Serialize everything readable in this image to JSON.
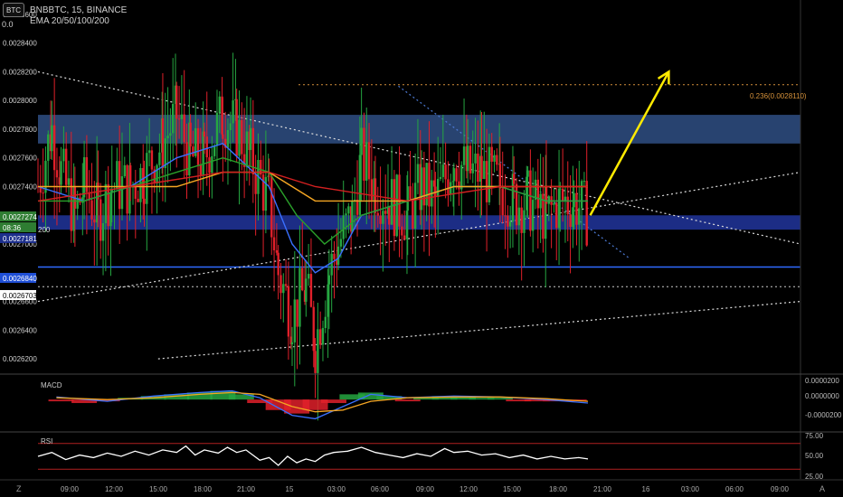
{
  "header": {
    "badge": "BTC",
    "symbol_line": "BNBBTC, 15, BINANCE",
    "indicator_line": "EMA 20/50/100/200",
    "partial_top_label": "0.0"
  },
  "price_labels": {
    "current_price": "0.0027274",
    "countdown": "08:36",
    "partial_label": "200",
    "level_price": "0.0027181",
    "support_price": "0.0026840",
    "dotted_price": "0.0026703"
  },
  "fib_label": "0.236(0.0028110)",
  "macd": {
    "label": "MACD",
    "ticks": [
      "0.0000200",
      "0.0000000",
      "-0.0000200"
    ]
  },
  "rsi": {
    "label": "RSI",
    "ticks": [
      "75.00",
      "50.00",
      "25.00"
    ]
  },
  "corner_icons": {
    "left": "Z",
    "right": "A"
  },
  "colors": {
    "background": "#000000",
    "up_candle": "#26a641",
    "down_candle": "#e0202a",
    "supply_zone": "#2c4a7c",
    "demand_zone": "#1d2f8c",
    "arrow": "#ffea00",
    "fib": "#d4903a",
    "rsi_line": "#ffffff",
    "rsi_bands": "#b02020"
  },
  "chart_data": {
    "type": "candlestick",
    "y_axis_ticks": [
      "0.0028600",
      "0.0028400",
      "0.0028200",
      "0.0028000",
      "0.0027800",
      "0.0027600",
      "0.0027400",
      "0.0027000",
      "0.0026600",
      "0.0026400",
      "0.0026200"
    ],
    "ylim": [
      0.00261,
      0.00287
    ],
    "x_ticks": [
      "09:00",
      "12:00",
      "15:00",
      "18:00",
      "21:00",
      "15",
      "03:00",
      "06:00",
      "09:00",
      "12:00",
      "15:00",
      "18:00",
      "21:00",
      "16",
      "03:00",
      "06:00",
      "09:00"
    ],
    "xlim": [
      0,
      16.5
    ],
    "price_path": [
      [
        0.0,
        0.00274
      ],
      [
        0.3,
        0.00278
      ],
      [
        0.5,
        0.00275
      ],
      [
        0.8,
        0.00272
      ],
      [
        1.0,
        0.00274
      ],
      [
        1.3,
        0.00272
      ],
      [
        1.6,
        0.00274
      ],
      [
        2.0,
        0.00274
      ],
      [
        2.3,
        0.00275
      ],
      [
        2.7,
        0.00277
      ],
      [
        3.0,
        0.00279
      ],
      [
        3.3,
        0.00276
      ],
      [
        3.6,
        0.00276
      ],
      [
        4.0,
        0.00279
      ],
      [
        4.3,
        0.00278
      ],
      [
        4.6,
        0.00276
      ],
      [
        5.0,
        0.00273
      ],
      [
        5.2,
        0.00268
      ],
      [
        5.5,
        0.00265
      ],
      [
        5.8,
        0.00267
      ],
      [
        6.0,
        0.00263
      ],
      [
        6.3,
        0.00268
      ],
      [
        6.5,
        0.0027
      ],
      [
        6.8,
        0.00272
      ],
      [
        7.0,
        0.00276
      ],
      [
        7.3,
        0.00274
      ],
      [
        7.6,
        0.00273
      ],
      [
        8.0,
        0.00272
      ],
      [
        8.3,
        0.00274
      ],
      [
        8.6,
        0.00273
      ],
      [
        9.0,
        0.00276
      ],
      [
        9.3,
        0.00275
      ],
      [
        9.6,
        0.00275
      ],
      [
        10.0,
        0.00274
      ],
      [
        10.3,
        0.00273
      ],
      [
        10.6,
        0.00273
      ],
      [
        11.0,
        0.00272
      ],
      [
        11.3,
        0.00273
      ],
      [
        11.6,
        0.00273
      ],
      [
        11.9,
        0.00272
      ]
    ],
    "ema_lines": [
      {
        "name": "EMA 20",
        "color": "#3a70ff",
        "points": [
          [
            0,
            0.00274
          ],
          [
            1,
            0.00273
          ],
          [
            2,
            0.00274
          ],
          [
            3,
            0.00276
          ],
          [
            4,
            0.00277
          ],
          [
            5,
            0.00274
          ],
          [
            5.5,
            0.0027
          ],
          [
            6,
            0.00268
          ],
          [
            6.5,
            0.00269
          ],
          [
            7,
            0.00272
          ],
          [
            8,
            0.00273
          ],
          [
            9,
            0.00274
          ],
          [
            10,
            0.00274
          ],
          [
            11,
            0.00273
          ],
          [
            11.9,
            0.00273
          ]
        ]
      },
      {
        "name": "EMA 50",
        "color": "#2aa02a",
        "points": [
          [
            0,
            0.00273
          ],
          [
            1,
            0.00273
          ],
          [
            2,
            0.00274
          ],
          [
            3,
            0.00275
          ],
          [
            4,
            0.00276
          ],
          [
            5,
            0.00275
          ],
          [
            5.6,
            0.00272
          ],
          [
            6.2,
            0.0027
          ],
          [
            7,
            0.00272
          ],
          [
            8,
            0.00273
          ],
          [
            9,
            0.00274
          ],
          [
            10,
            0.00274
          ],
          [
            11,
            0.00273
          ],
          [
            11.9,
            0.00273
          ]
        ]
      },
      {
        "name": "EMA 100",
        "color": "#f5a623",
        "points": [
          [
            0,
            0.00274
          ],
          [
            1,
            0.00274
          ],
          [
            2,
            0.00274
          ],
          [
            3,
            0.00274
          ],
          [
            4,
            0.00275
          ],
          [
            5,
            0.00275
          ],
          [
            6,
            0.00273
          ],
          [
            7,
            0.00273
          ],
          [
            8,
            0.00273
          ],
          [
            9,
            0.00274
          ],
          [
            10,
            0.00274
          ],
          [
            11,
            0.00274
          ],
          [
            11.9,
            0.00274
          ]
        ]
      },
      {
        "name": "EMA 200",
        "color": "#d42020",
        "points": [
          [
            0,
            0.00273
          ],
          [
            2,
            0.00274
          ],
          [
            4,
            0.00275
          ],
          [
            5,
            0.00275
          ],
          [
            6,
            0.00274
          ],
          [
            8,
            0.00273
          ],
          [
            10,
            0.00274
          ],
          [
            11.9,
            0.00274
          ]
        ]
      }
    ],
    "zones": [
      {
        "name": "supply",
        "from": 0.00277,
        "to": 0.00279
      },
      {
        "name": "demand",
        "from": 0.00271,
        "to": 0.00272
      }
    ],
    "horizontal_lines": [
      {
        "name": "support",
        "value": 0.002684,
        "style": "solid"
      },
      {
        "name": "dotted",
        "value": 0.0026703,
        "style": "dotted"
      },
      {
        "name": "fib-0.236",
        "value": 0.002811,
        "style": "dotted"
      }
    ],
    "trendlines": [
      {
        "name": "descending-resistance",
        "from": [
          0,
          0.00282
        ],
        "to": [
          16.5,
          0.0027
        ]
      },
      {
        "name": "ascending-support",
        "from": [
          0,
          0.00266
        ],
        "to": [
          16.5,
          0.00275
        ]
      },
      {
        "name": "lower-ascending",
        "from": [
          2.6,
          0.00262
        ],
        "to": [
          16.5,
          0.00266
        ]
      },
      {
        "name": "steep-descending",
        "from": [
          7.8,
          0.00281
        ],
        "to": [
          12.8,
          0.00269
        ]
      }
    ],
    "arrow": {
      "from": [
        11.95,
        0.00272
      ],
      "to": [
        13.65,
        0.00282
      ]
    },
    "macd": {
      "ylim": [
        -3.5e-05,
        2.5e-05
      ],
      "histogram": [
        [
          0.5,
          -2e-06
        ],
        [
          1,
          -4e-06
        ],
        [
          1.5,
          -2e-06
        ],
        [
          2,
          2e-06
        ],
        [
          2.5,
          4e-06
        ],
        [
          3,
          6e-06
        ],
        [
          3.5,
          8e-06
        ],
        [
          4,
          1e-05
        ],
        [
          4.4,
          6e-06
        ],
        [
          4.8,
          -4e-06
        ],
        [
          5.2,
          -1.2e-05
        ],
        [
          5.6,
          -1.6e-05
        ],
        [
          6,
          -1.2e-05
        ],
        [
          6.4,
          -4e-06
        ],
        [
          6.8,
          6e-06
        ],
        [
          7.2,
          8e-06
        ],
        [
          7.6,
          4e-06
        ],
        [
          8,
          -2e-06
        ],
        [
          8.4,
          2e-06
        ],
        [
          8.8,
          4e-06
        ],
        [
          9.2,
          4e-06
        ],
        [
          9.6,
          2e-06
        ],
        [
          10,
          2e-06
        ],
        [
          10.4,
          -2e-06
        ],
        [
          10.8,
          -2e-06
        ],
        [
          11.2,
          -2e-06
        ],
        [
          11.6,
          -2e-06
        ]
      ],
      "macd_line": [
        [
          0.4,
          3e-06
        ],
        [
          1.5,
          -2e-06
        ],
        [
          2.5,
          4e-06
        ],
        [
          3.5,
          8e-06
        ],
        [
          4.2,
          1e-05
        ],
        [
          4.8,
          2e-06
        ],
        [
          5.5,
          -1.8e-05
        ],
        [
          6,
          -2.2e-05
        ],
        [
          6.6,
          -8e-06
        ],
        [
          7.2,
          6e-06
        ],
        [
          8,
          2e-06
        ],
        [
          9,
          4e-06
        ],
        [
          10,
          3e-06
        ],
        [
          11,
          0.0
        ],
        [
          11.9,
          -4e-06
        ]
      ],
      "signal_line": [
        [
          0.4,
          2e-06
        ],
        [
          1.5,
          0.0
        ],
        [
          2.5,
          2e-06
        ],
        [
          3.5,
          6e-06
        ],
        [
          4.2,
          8e-06
        ],
        [
          4.8,
          6e-06
        ],
        [
          5.5,
          -8e-06
        ],
        [
          6,
          -1.4e-05
        ],
        [
          6.6,
          -1.2e-05
        ],
        [
          7.2,
          -2e-06
        ],
        [
          8,
          2e-06
        ],
        [
          9,
          3e-06
        ],
        [
          10,
          3e-06
        ],
        [
          11,
          1e-06
        ],
        [
          11.9,
          -2e-06
        ]
      ]
    },
    "rsi": {
      "ylim": [
        15,
        85
      ],
      "points": [
        [
          0,
          50
        ],
        [
          0.3,
          56
        ],
        [
          0.6,
          45
        ],
        [
          0.9,
          52
        ],
        [
          1.2,
          48
        ],
        [
          1.5,
          55
        ],
        [
          1.8,
          50
        ],
        [
          2.1,
          58
        ],
        [
          2.4,
          52
        ],
        [
          2.7,
          60
        ],
        [
          3.0,
          56
        ],
        [
          3.2,
          66
        ],
        [
          3.4,
          52
        ],
        [
          3.6,
          60
        ],
        [
          3.9,
          55
        ],
        [
          4.1,
          64
        ],
        [
          4.3,
          56
        ],
        [
          4.5,
          60
        ],
        [
          4.8,
          44
        ],
        [
          5.0,
          48
        ],
        [
          5.2,
          36
        ],
        [
          5.4,
          50
        ],
        [
          5.6,
          40
        ],
        [
          5.8,
          46
        ],
        [
          6.0,
          42
        ],
        [
          6.2,
          52
        ],
        [
          6.4,
          56
        ],
        [
          6.7,
          58
        ],
        [
          7.0,
          64
        ],
        [
          7.3,
          56
        ],
        [
          7.6,
          52
        ],
        [
          7.9,
          48
        ],
        [
          8.2,
          54
        ],
        [
          8.5,
          50
        ],
        [
          8.8,
          62
        ],
        [
          9.0,
          56
        ],
        [
          9.3,
          58
        ],
        [
          9.6,
          52
        ],
        [
          9.9,
          54
        ],
        [
          10.2,
          48
        ],
        [
          10.5,
          52
        ],
        [
          10.8,
          46
        ],
        [
          11.1,
          50
        ],
        [
          11.4,
          46
        ],
        [
          11.7,
          48
        ],
        [
          11.9,
          46
        ]
      ]
    }
  }
}
